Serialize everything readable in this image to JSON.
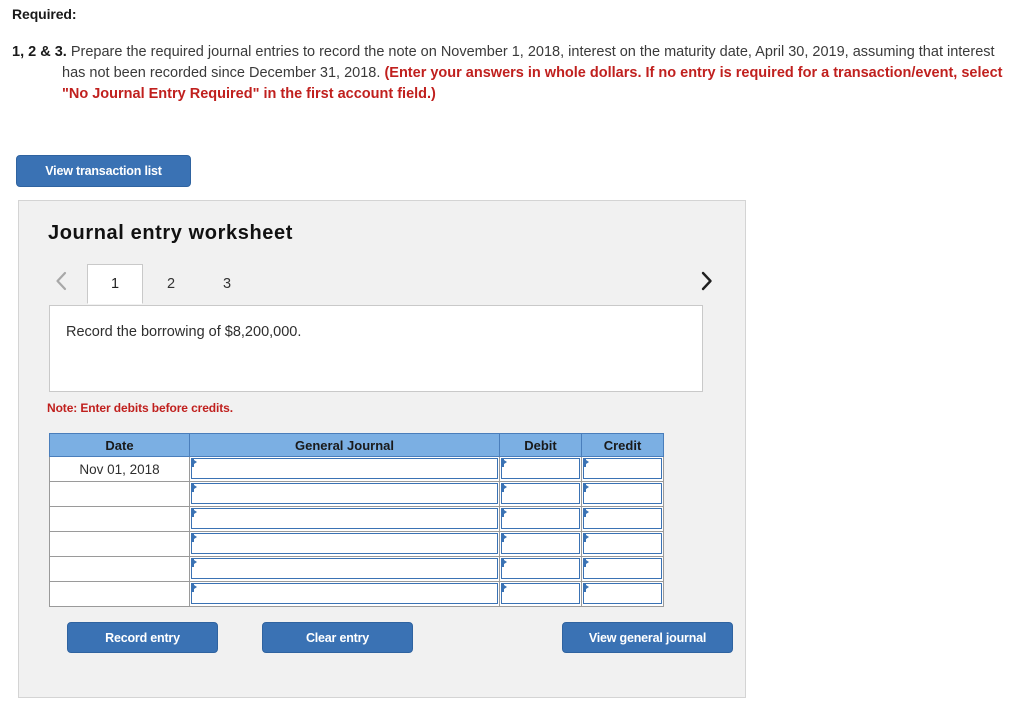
{
  "question": {
    "required_label": "Required:",
    "number": "1, 2 & 3.",
    "text_part_1": "Prepare the required journal entries to record the note on November 1, 2018, interest on the maturity date, April 30, 2019, assuming that interest has not been recorded since December 31, 2018.",
    "text_red": "(Enter your answers in whole dollars. If no entry is required for a transaction/event, select \"No Journal Entry Required\" in the first account field.)"
  },
  "toolbar": {
    "view_transaction_list": "View transaction list"
  },
  "worksheet": {
    "title": "Journal entry worksheet",
    "prev_icon": "chevron-left-icon",
    "next_icon": "chevron-right-icon",
    "tabs": [
      {
        "label": "1",
        "active": true
      },
      {
        "label": "2",
        "active": false
      },
      {
        "label": "3",
        "active": false
      }
    ],
    "instruction": "Record the borrowing of $8,200,000.",
    "note": "Note: Enter debits before credits."
  },
  "table": {
    "columns": [
      "Date",
      "General Journal",
      "Debit",
      "Credit"
    ],
    "rows": [
      {
        "date": "Nov 01, 2018",
        "general_journal": "",
        "debit": "",
        "credit": ""
      },
      {
        "date": "",
        "general_journal": "",
        "debit": "",
        "credit": ""
      },
      {
        "date": "",
        "general_journal": "",
        "debit": "",
        "credit": ""
      },
      {
        "date": "",
        "general_journal": "",
        "debit": "",
        "credit": ""
      },
      {
        "date": "",
        "general_journal": "",
        "debit": "",
        "credit": ""
      },
      {
        "date": "",
        "general_journal": "",
        "debit": "",
        "credit": ""
      }
    ]
  },
  "footer": {
    "record_entry": "Record entry",
    "clear_entry": "Clear entry",
    "view_general_journal": "View general journal"
  },
  "colors": {
    "button_blue": "#3a72b4",
    "header_blue": "#7bafe3",
    "alert_red": "#c0201e",
    "panel_gray": "#f1f1f1"
  }
}
